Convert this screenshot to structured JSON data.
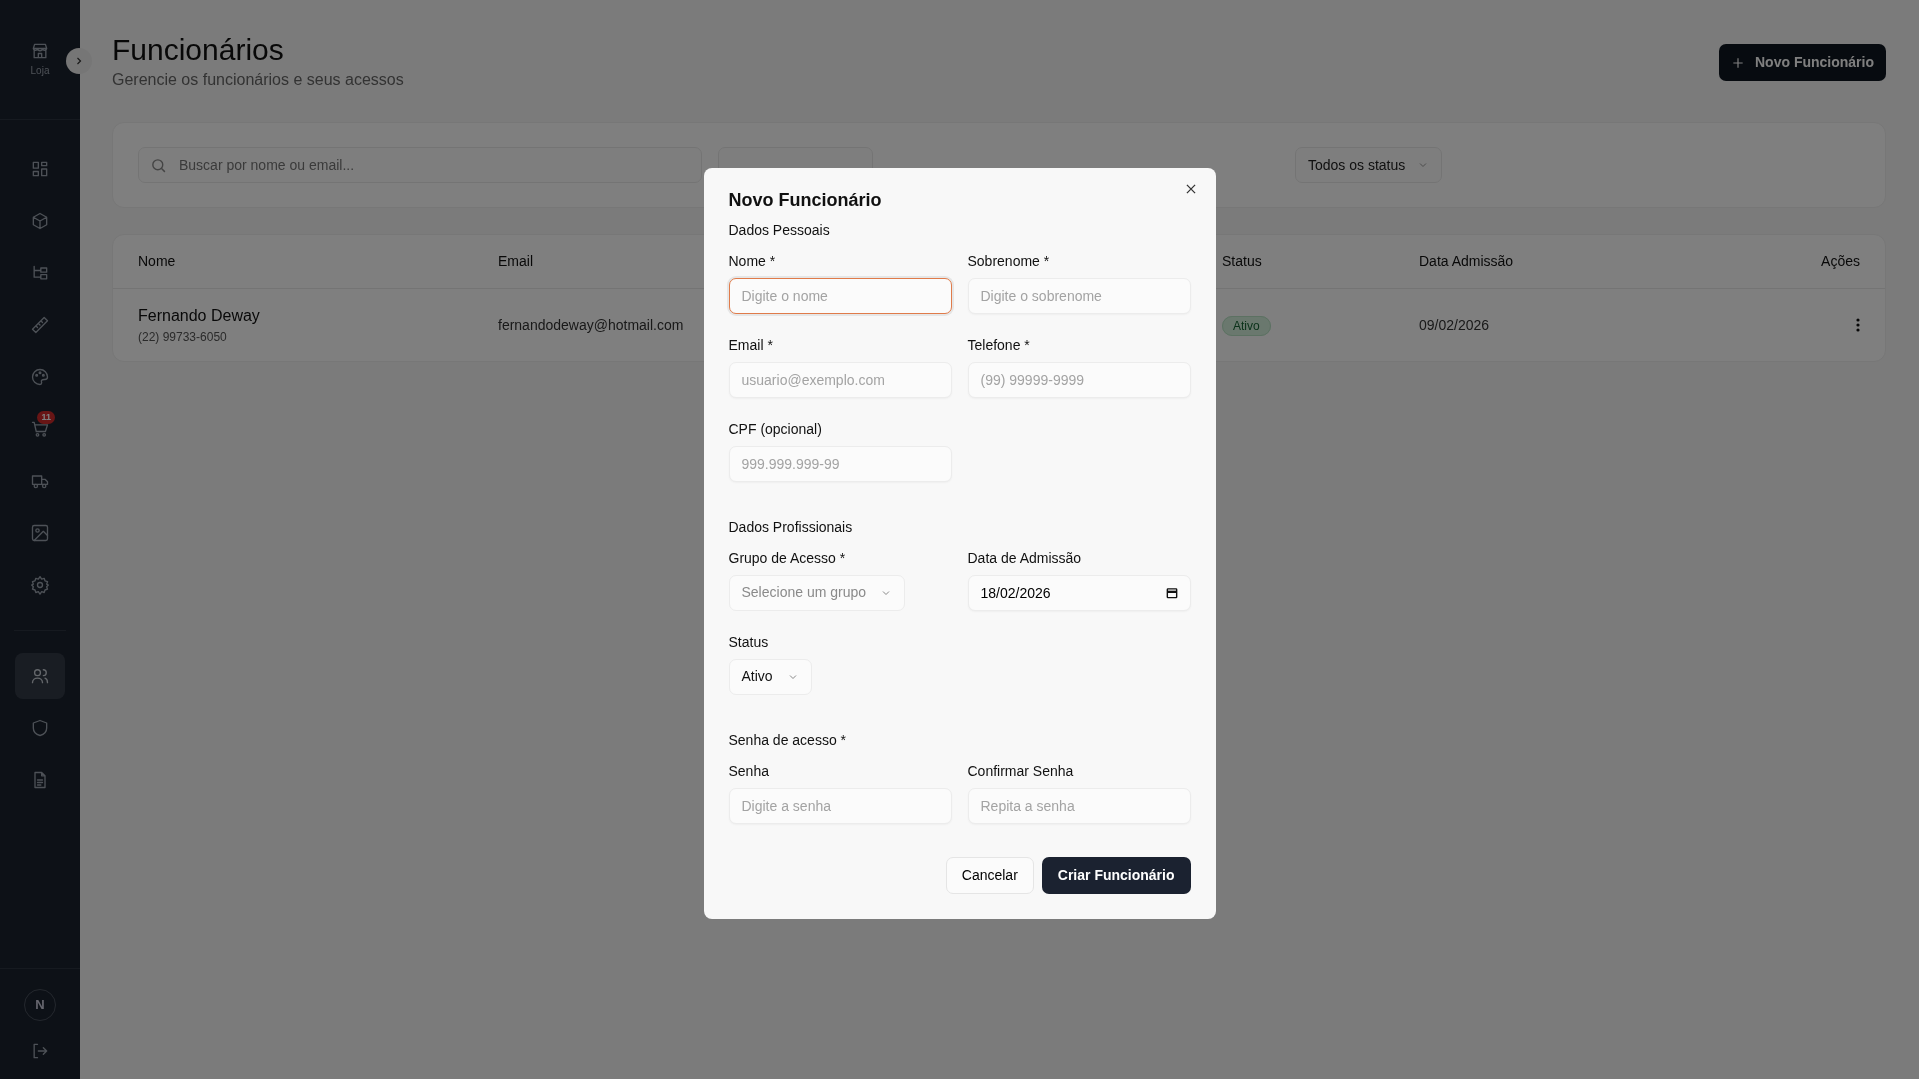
{
  "sidebar": {
    "brand": {
      "label": "Loja"
    },
    "items": [
      {
        "kind": "grid",
        "selected": false
      },
      {
        "kind": "box",
        "selected": false
      },
      {
        "kind": "tree",
        "selected": false
      },
      {
        "kind": "ruler",
        "selected": false
      },
      {
        "kind": "palette",
        "selected": false
      },
      {
        "kind": "cart",
        "selected": false,
        "badge": "11"
      },
      {
        "kind": "truck",
        "selected": false
      },
      {
        "kind": "image",
        "selected": false
      },
      {
        "kind": "gear",
        "selected": false
      },
      {
        "kind": "divider"
      },
      {
        "kind": "users",
        "selected": true
      },
      {
        "kind": "shield",
        "selected": false
      },
      {
        "kind": "document",
        "selected": false
      }
    ],
    "avatar": "N"
  },
  "header": {
    "title": "Funcionários",
    "subtitle": "Gerencie os funcionários e seus acessos",
    "new_button": "Novo Funcionário"
  },
  "filters": {
    "search": {
      "placeholder": "Buscar por nome ou email..."
    },
    "status_select": "Todos os status"
  },
  "table": {
    "columns": [
      "Nome",
      "Email",
      "Status",
      "Data Admissão",
      "Ações"
    ],
    "rows": [
      {
        "name": "Fernando Deway",
        "phone": "(22) 99733-6050",
        "email": "fernandodeway@hotmail.com",
        "status": "Ativo",
        "admission": "09/02/2026"
      }
    ]
  },
  "modal": {
    "title": "Novo Funcionário",
    "sections": [
      {
        "title": "Dados Pessoais",
        "rows": [
          [
            {
              "kind": "text",
              "label": "Nome *",
              "placeholder": "Digite o nome",
              "focused": true
            },
            {
              "kind": "text",
              "label": "Sobrenome *",
              "placeholder": "Digite o sobrenome",
              "focused": false
            }
          ],
          [
            {
              "kind": "text",
              "label": "Email *",
              "placeholder": "usuario@exemplo.com",
              "focused": false
            },
            {
              "kind": "text",
              "label": "Telefone *",
              "placeholder": "(99) 99999-9999",
              "focused": false
            }
          ],
          [
            {
              "kind": "text",
              "label": "CPF (opcional)",
              "placeholder": "999.999.999-99",
              "focused": false
            }
          ]
        ]
      },
      {
        "title": "Dados Profissionais",
        "rows": [
          [
            {
              "kind": "select",
              "label": "Grupo de Acesso *",
              "placeholder": "Selecione um grupo"
            },
            {
              "kind": "date",
              "label": "Data de Admissão",
              "value": "18/02/2026"
            }
          ],
          [
            {
              "kind": "select",
              "label": "Status",
              "value": "Ativo"
            }
          ]
        ]
      },
      {
        "title": "Senha de acesso *",
        "rows": [
          [
            {
              "kind": "text",
              "label": "Senha",
              "placeholder": "Digite a senha",
              "focused": false
            },
            {
              "kind": "text",
              "label": "Confirmar Senha",
              "placeholder": "Repita a senha",
              "focused": false
            }
          ]
        ]
      }
    ],
    "cancel_button": "Cancelar",
    "submit_button": "Criar Funcionário"
  }
}
